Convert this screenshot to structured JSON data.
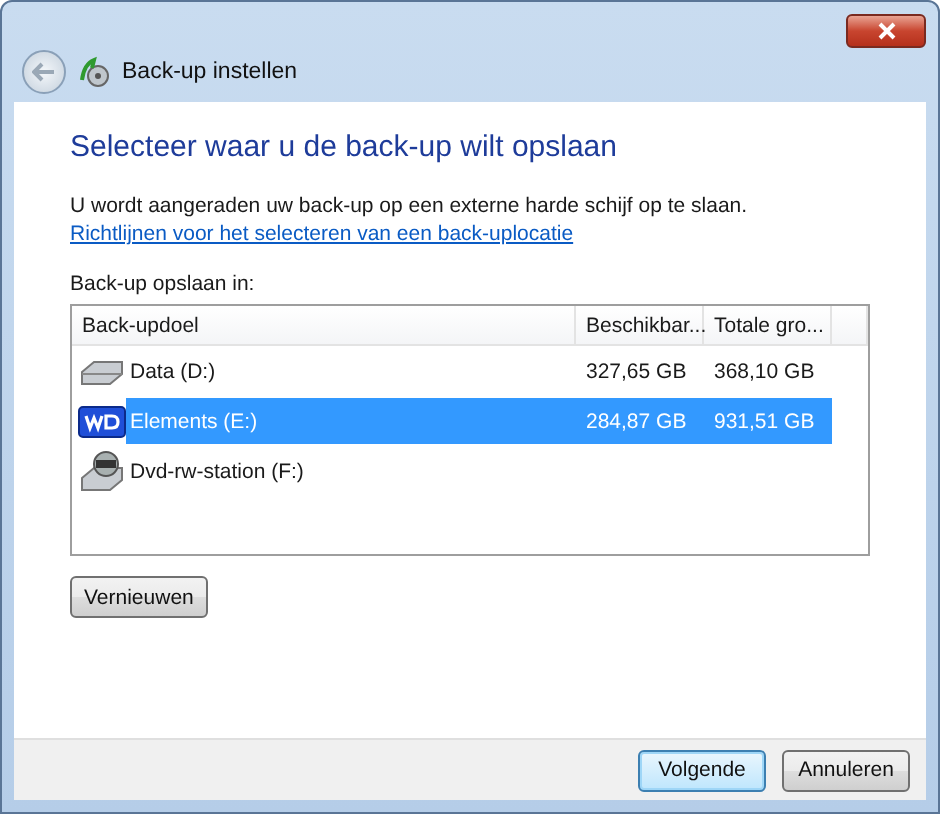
{
  "window": {
    "title": "Back-up instellen"
  },
  "heading": "Selecteer waar u de back-up wilt opslaan",
  "intro": {
    "text": "U wordt aangeraden uw back-up op een externe harde schijf op te slaan.",
    "link": "Richtlijnen voor het selecteren van een back-uplocatie"
  },
  "list_label": "Back-up opslaan in:",
  "table": {
    "columns": [
      "Back-updoel",
      "Beschikbar...",
      "Totale gro..."
    ],
    "rows": [
      {
        "kind": "hdd",
        "name": "Data (D:)",
        "available": "327,65 GB",
        "total": "368,10 GB",
        "selected": false
      },
      {
        "kind": "wd",
        "name": "Elements (E:)",
        "available": "284,87 GB",
        "total": "931,51 GB",
        "selected": true
      },
      {
        "kind": "dvd",
        "name": "Dvd-rw-station (F:)",
        "selected": false
      }
    ]
  },
  "refresh_button": "Vernieuwen",
  "buttons": [
    {
      "label": "Volgende",
      "default": true
    },
    {
      "label": "Annuleren",
      "default": false
    }
  ]
}
